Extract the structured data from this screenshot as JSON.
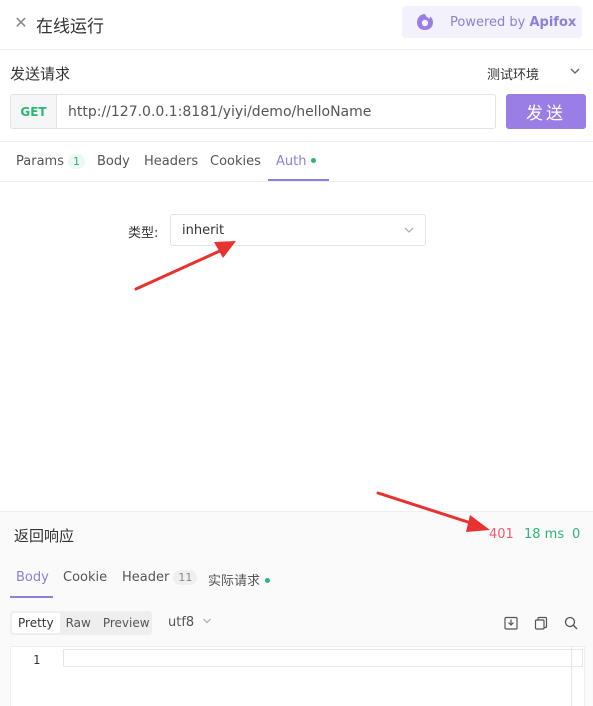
{
  "header": {
    "close_icon": "close-icon",
    "title": "在线运行",
    "powered_prefix": "Powered by ",
    "powered_brand": "Apifox",
    "brand_color": "#8f7fd6"
  },
  "request": {
    "title": "发送请求",
    "environment": "测试环境",
    "method": "GET",
    "url": "http://127.0.0.1:8181/yiyi/demo/helloName",
    "send_label": "发送",
    "tabs": [
      {
        "label": "Params",
        "badge": "1"
      },
      {
        "label": "Body"
      },
      {
        "label": "Headers"
      },
      {
        "label": "Cookies"
      },
      {
        "label": "Auth",
        "active": true,
        "dot": true
      }
    ]
  },
  "auth": {
    "type_label": "类型:",
    "type_value": "inherit"
  },
  "response": {
    "title": "返回响应",
    "status_code": "401",
    "time": "18 ms",
    "size": "0",
    "tabs": [
      {
        "label": "Body",
        "active": true
      },
      {
        "label": "Cookie"
      },
      {
        "label": "Header",
        "badge": "11"
      },
      {
        "label": "实际请求",
        "dot": true
      }
    ],
    "formats": [
      "Pretty",
      "Raw",
      "Preview"
    ],
    "active_format": "Pretty",
    "encoding": "utf8",
    "line_number": "1"
  },
  "colors": {
    "accent": "#9a7ee6",
    "success": "#2bb673",
    "error": "#ee5b6b",
    "annotation": "#e8322f"
  }
}
